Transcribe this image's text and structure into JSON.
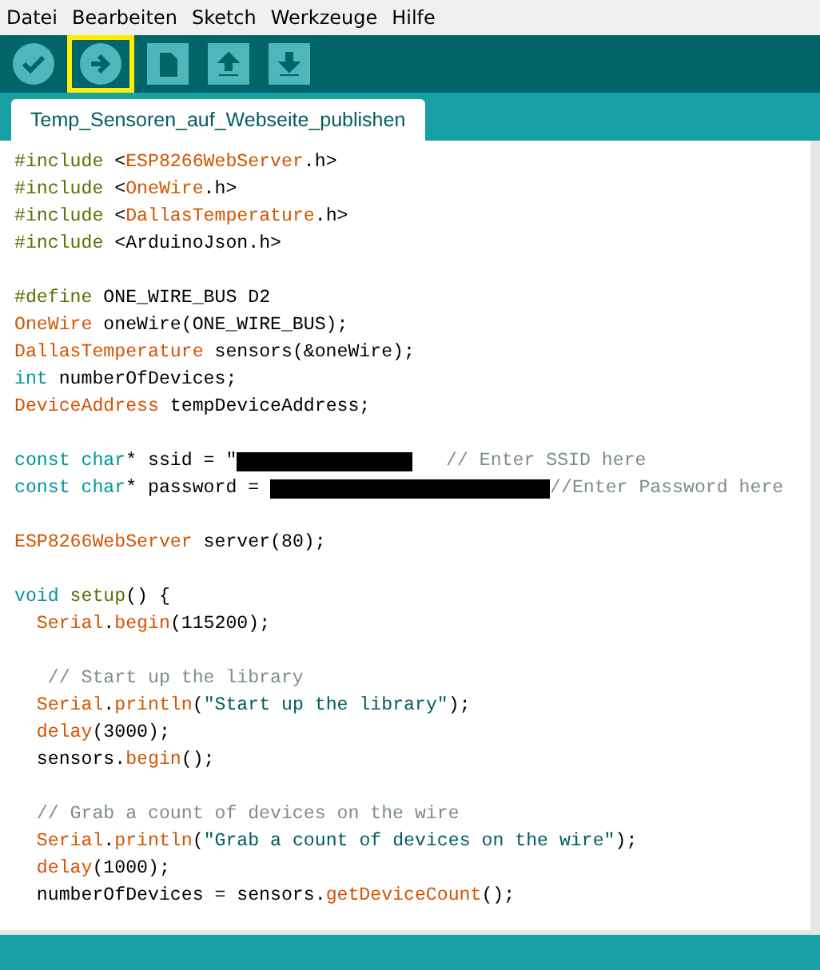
{
  "menu": [
    {
      "label": "Datei"
    },
    {
      "label": "Bearbeiten"
    },
    {
      "label": "Sketch"
    },
    {
      "label": "Werkzeuge"
    },
    {
      "label": "Hilfe"
    }
  ],
  "toolbar": [
    {
      "kind": "verify",
      "highlighted": false
    },
    {
      "kind": "upload",
      "highlighted": true
    },
    {
      "kind": "new",
      "highlighted": false
    },
    {
      "kind": "open",
      "highlighted": false
    },
    {
      "kind": "save",
      "highlighted": false
    }
  ],
  "tabs": [
    {
      "label": "Temp_Sensoren_auf_Webseite_publishen",
      "selected": true
    }
  ],
  "code": [
    {
      "kind": "code",
      "tokens": [
        {
          "kind": "pre",
          "text": "#include"
        },
        {
          "kind": "plain",
          "text": " <"
        },
        {
          "kind": "type",
          "text": "ESP8266WebServer"
        },
        {
          "kind": "plain",
          "text": ".h>"
        }
      ]
    },
    {
      "kind": "code",
      "tokens": [
        {
          "kind": "pre",
          "text": "#include"
        },
        {
          "kind": "plain",
          "text": " <"
        },
        {
          "kind": "type",
          "text": "OneWire"
        },
        {
          "kind": "plain",
          "text": ".h>"
        }
      ]
    },
    {
      "kind": "code",
      "tokens": [
        {
          "kind": "pre",
          "text": "#include"
        },
        {
          "kind": "plain",
          "text": " <"
        },
        {
          "kind": "type",
          "text": "DallasTemperature"
        },
        {
          "kind": "plain",
          "text": ".h>"
        }
      ]
    },
    {
      "kind": "code",
      "tokens": [
        {
          "kind": "pre",
          "text": "#include"
        },
        {
          "kind": "plain",
          "text": " <ArduinoJson.h>"
        }
      ]
    },
    {
      "kind": "blank"
    },
    {
      "kind": "code",
      "tokens": [
        {
          "kind": "pre",
          "text": "#define"
        },
        {
          "kind": "plain",
          "text": " ONE_WIRE_BUS D2"
        }
      ]
    },
    {
      "kind": "code",
      "tokens": [
        {
          "kind": "type",
          "text": "OneWire"
        },
        {
          "kind": "plain",
          "text": " oneWire(ONE_WIRE_BUS);"
        }
      ]
    },
    {
      "kind": "code",
      "tokens": [
        {
          "kind": "type",
          "text": "DallasTemperature"
        },
        {
          "kind": "plain",
          "text": " sensors(&oneWire);"
        }
      ]
    },
    {
      "kind": "code",
      "tokens": [
        {
          "kind": "keyword",
          "text": "int"
        },
        {
          "kind": "plain",
          "text": " numberOfDevices;"
        }
      ]
    },
    {
      "kind": "code",
      "tokens": [
        {
          "kind": "type",
          "text": "DeviceAddress"
        },
        {
          "kind": "plain",
          "text": " tempDeviceAddress;"
        }
      ]
    },
    {
      "kind": "blank"
    },
    {
      "kind": "code",
      "tokens": [
        {
          "kind": "keyword",
          "text": "const char"
        },
        {
          "kind": "plain",
          "text": "* ssid = \""
        },
        {
          "kind": "redacted"
        },
        {
          "kind": "comment",
          "text": "   // Enter SSID here"
        }
      ]
    },
    {
      "kind": "code",
      "tokens": [
        {
          "kind": "keyword",
          "text": "const char"
        },
        {
          "kind": "plain",
          "text": "* password = "
        },
        {
          "kind": "redacted"
        },
        {
          "kind": "comment",
          "text": "//Enter Password here"
        }
      ]
    },
    {
      "kind": "blank"
    },
    {
      "kind": "code",
      "tokens": [
        {
          "kind": "type",
          "text": "ESP8266WebServer"
        },
        {
          "kind": "plain",
          "text": " server(80);"
        }
      ]
    },
    {
      "kind": "blank"
    },
    {
      "kind": "code",
      "tokens": [
        {
          "kind": "keyword",
          "text": "void"
        },
        {
          "kind": "pre",
          "text": " setup"
        },
        {
          "kind": "plain",
          "text": "() {"
        }
      ]
    },
    {
      "kind": "code",
      "tokens": [
        {
          "kind": "type",
          "text": "  Serial"
        },
        {
          "kind": "plain",
          "text": "."
        },
        {
          "kind": "type",
          "text": "begin"
        },
        {
          "kind": "plain",
          "text": "(115200);"
        }
      ]
    },
    {
      "kind": "blank"
    },
    {
      "kind": "code",
      "tokens": [
        {
          "kind": "comment",
          "text": "   // Start up the library"
        }
      ]
    },
    {
      "kind": "code",
      "tokens": [
        {
          "kind": "type",
          "text": "  Serial"
        },
        {
          "kind": "plain",
          "text": "."
        },
        {
          "kind": "type",
          "text": "println"
        },
        {
          "kind": "plain",
          "text": "("
        },
        {
          "kind": "string",
          "text": "\"Start up the library\""
        },
        {
          "kind": "plain",
          "text": ");"
        }
      ]
    },
    {
      "kind": "code",
      "tokens": [
        {
          "kind": "type",
          "text": "  delay"
        },
        {
          "kind": "plain",
          "text": "(3000);"
        }
      ]
    },
    {
      "kind": "code",
      "tokens": [
        {
          "kind": "plain",
          "text": "  sensors."
        },
        {
          "kind": "type",
          "text": "begin"
        },
        {
          "kind": "plain",
          "text": "();"
        }
      ]
    },
    {
      "kind": "blank"
    },
    {
      "kind": "code",
      "tokens": [
        {
          "kind": "comment",
          "text": "  // Grab a count of devices on the wire"
        }
      ]
    },
    {
      "kind": "code",
      "tokens": [
        {
          "kind": "type",
          "text": "  Serial"
        },
        {
          "kind": "plain",
          "text": "."
        },
        {
          "kind": "type",
          "text": "println"
        },
        {
          "kind": "plain",
          "text": "("
        },
        {
          "kind": "string",
          "text": "\"Grab a count of devices on the wire\""
        },
        {
          "kind": "plain",
          "text": ");"
        }
      ]
    },
    {
      "kind": "code",
      "tokens": [
        {
          "kind": "type",
          "text": "  delay"
        },
        {
          "kind": "plain",
          "text": "(1000);"
        }
      ]
    },
    {
      "kind": "code",
      "tokens": [
        {
          "kind": "plain",
          "text": "  numberOfDevices = sensors."
        },
        {
          "kind": "type",
          "text": "getDeviceCount"
        },
        {
          "kind": "plain",
          "text": "();"
        }
      ]
    }
  ]
}
